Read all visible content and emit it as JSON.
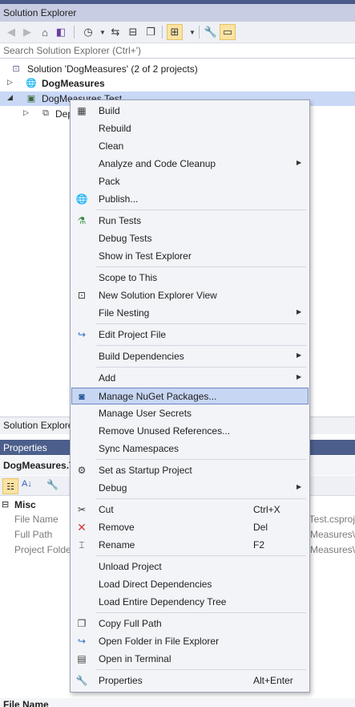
{
  "window": {
    "title": "Solution Explorer"
  },
  "toolbar": {
    "buttons": [
      "back-icon",
      "forward-icon",
      "home-icon",
      "vs-switch-icon",
      "history-icon",
      "sync-icon",
      "collapse-icon",
      "copy-icon",
      "show-all-files-icon",
      "properties-icon",
      "preview-icon"
    ]
  },
  "search": {
    "placeholder": "Search Solution Explorer (Ctrl+')"
  },
  "tree": {
    "solution": "Solution 'DogMeasures' (2 of 2 projects)",
    "project1": "DogMeasures",
    "project2": "DogMeasures.Test",
    "deps": "Dependencies"
  },
  "bottom": {
    "tab_label": "Solution Explorer",
    "properties_title": "Properties",
    "selected_object": "DogMeasures.Test",
    "misc": "Misc",
    "rows": [
      {
        "name": "File Name",
        "value": "DogMeasures.Test.csproj"
      },
      {
        "name": "Full Path",
        "value": "C:\\source\\DogMeasures\\"
      },
      {
        "name": "Project Folder",
        "value": "C:\\source\\DogMeasures\\"
      }
    ],
    "footer_label": "File Name"
  },
  "menu": {
    "items": [
      {
        "label": "Build",
        "icon": "build-icon"
      },
      {
        "label": "Rebuild"
      },
      {
        "label": "Clean"
      },
      {
        "label": "Analyze and Code Cleanup",
        "submenu": true
      },
      {
        "label": "Pack"
      },
      {
        "label": "Publish...",
        "icon": "globe-icon"
      },
      {
        "label": "Run Tests",
        "icon": "flask-icon"
      },
      {
        "label": "Debug Tests"
      },
      {
        "label": "Show in Test Explorer"
      },
      {
        "label": "Scope to This"
      },
      {
        "label": "New Solution Explorer View",
        "icon": "new-view-icon"
      },
      {
        "label": "File Nesting",
        "submenu": true
      },
      {
        "label": "Edit Project File",
        "icon": "edit-arrow-icon"
      },
      {
        "label": "Build Dependencies",
        "submenu": true
      },
      {
        "label": "Add",
        "submenu": true
      },
      {
        "label": "Manage NuGet Packages...",
        "icon": "nuget-icon"
      },
      {
        "label": "Manage User Secrets"
      },
      {
        "label": "Remove Unused References..."
      },
      {
        "label": "Sync Namespaces"
      },
      {
        "label": "Set as Startup Project",
        "icon": "gear-icon"
      },
      {
        "label": "Debug",
        "submenu": true
      },
      {
        "label": "Cut",
        "icon": "scissors-icon",
        "shortcut": "Ctrl+X"
      },
      {
        "label": "Remove",
        "icon": "red-x-icon",
        "shortcut": "Del"
      },
      {
        "label": "Rename",
        "icon": "rename-icon",
        "shortcut": "F2"
      },
      {
        "label": "Unload Project"
      },
      {
        "label": "Load Direct Dependencies"
      },
      {
        "label": "Load Entire Dependency Tree"
      },
      {
        "label": "Copy Full Path",
        "icon": "copy-path-icon"
      },
      {
        "label": "Open Folder in File Explorer",
        "icon": "folder-arrow-icon"
      },
      {
        "label": "Open in Terminal",
        "icon": "terminal-icon"
      },
      {
        "label": "Properties",
        "icon": "wrench-icon",
        "shortcut": "Alt+Enter"
      }
    ],
    "highlighted": "Manage NuGet Packages...",
    "submenu_arrow": "▶"
  },
  "colors": {
    "accent_highlight": "#c7d6f2",
    "title_bar": "#c8cde3",
    "selection": "#c9d8f5",
    "remove_icon": "#d9363e"
  }
}
